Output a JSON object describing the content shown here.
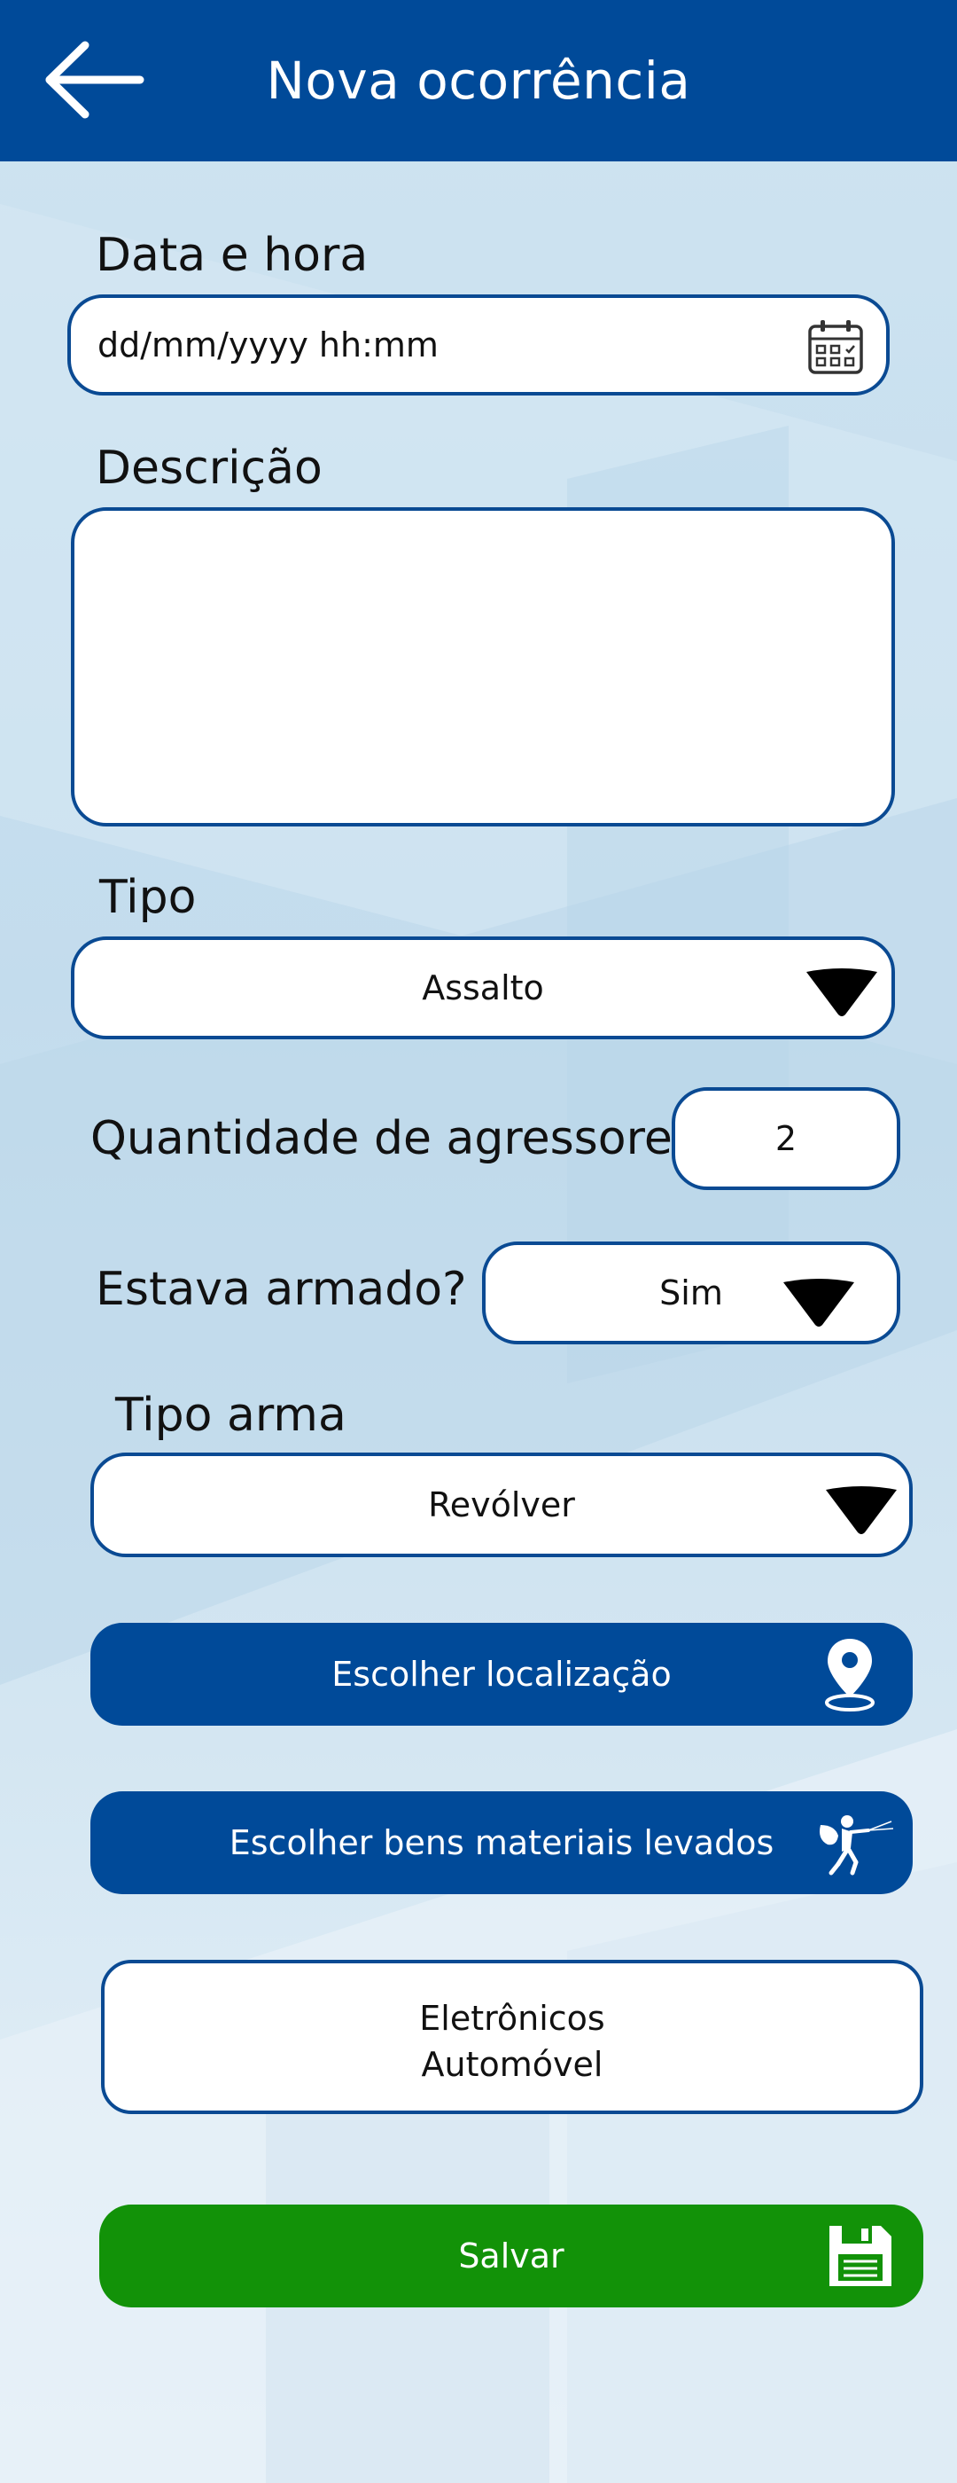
{
  "header": {
    "title": "Nova ocorrência",
    "back_icon": "arrow-left-icon"
  },
  "form": {
    "datetime": {
      "label": "Data e hora",
      "placeholder": "dd/mm/yyyy hh:mm",
      "icon": "calendar-icon"
    },
    "description": {
      "label": "Descrição",
      "value": ""
    },
    "type": {
      "label": "Tipo",
      "value": "Assalto"
    },
    "aggressors": {
      "label": "Quantidade de agressores",
      "value": "2"
    },
    "armed": {
      "label": "Estava armado?",
      "value": "Sim"
    },
    "weapon_type": {
      "label": "Tipo arma",
      "value": "Revólver"
    }
  },
  "actions": {
    "location_button": "Escolher localização",
    "location_icon": "map-pin-icon",
    "goods_button": "Escolher bens materiais levados",
    "goods_icon": "thief-icon",
    "selected_goods": [
      "Eletrônicos",
      "Automóvel"
    ],
    "save_button": "Salvar",
    "save_icon": "floppy-disk-icon"
  },
  "colors": {
    "primary": "#004a99",
    "border": "#0a4a93",
    "save": "#129208"
  }
}
